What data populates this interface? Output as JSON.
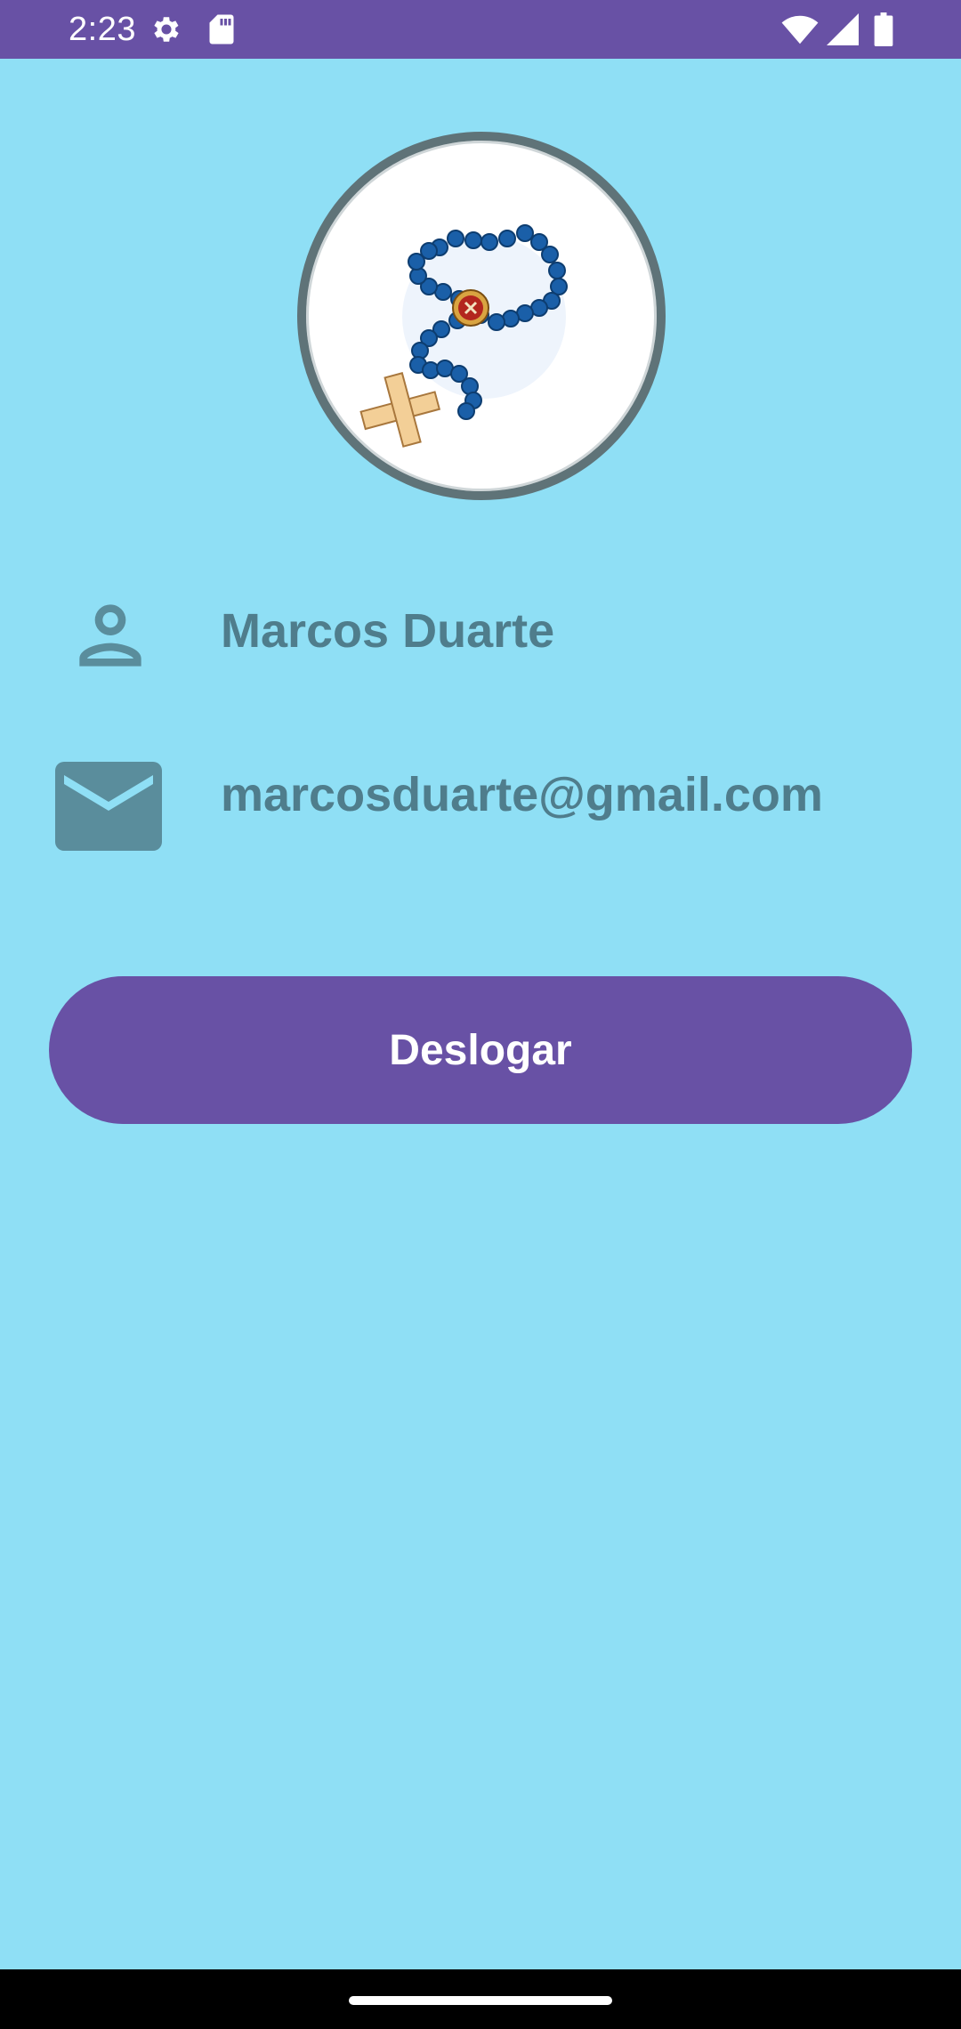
{
  "status_bar": {
    "time": "2:23",
    "icons": [
      "gear-icon",
      "sd-card-icon",
      "wifi-icon",
      "signal-icon",
      "battery-icon"
    ]
  },
  "profile": {
    "avatar": "rosary-image",
    "name": "Marcos Duarte",
    "email": "marcosduarte@gmail.com",
    "name_icon": "person-icon",
    "email_icon": "mail-icon"
  },
  "actions": {
    "logout_label": "Deslogar"
  },
  "colors": {
    "background": "#8fdff5",
    "primary": "#6851a5",
    "text_secondary": "#4f7d8c",
    "icon": "#5a8d9c"
  }
}
